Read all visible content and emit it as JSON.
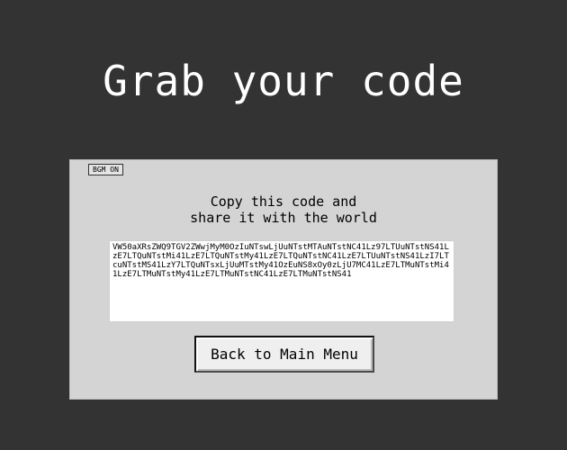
{
  "screen": {
    "title": "Grab your code"
  },
  "panel": {
    "bgm_toggle_label": "BGM ON",
    "instructions": {
      "line1": "Copy this code and",
      "line2": "share it with the world"
    },
    "code": "VW50aXRsZWQ9TGV2ZWwjMyM0OzIuNTswLjUuNTstMTAuNTstNC41Lz97LTUuNTstNS41LzE7LTQuNTstMi41LzE7LTQuNTstMy41LzE7LTQuNTstNC41LzE7LTUuNTstNS41LzI7LTcuNTstMS41LzY7LTQuNTsxLjUuMTstMy41OzEuNS8xOy0zLjU7MC41LzE7LTMuNTstMi41LzE7LTMuNTstMy41LzE7LTMuNTstNC41LzE7LTMuNTstNS41",
    "back_button_label": "Back to Main Menu"
  },
  "colors": {
    "background": "#333333",
    "panel": "#d4d4d4",
    "title_text": "#ffffff",
    "code_box": "#ffffff"
  }
}
